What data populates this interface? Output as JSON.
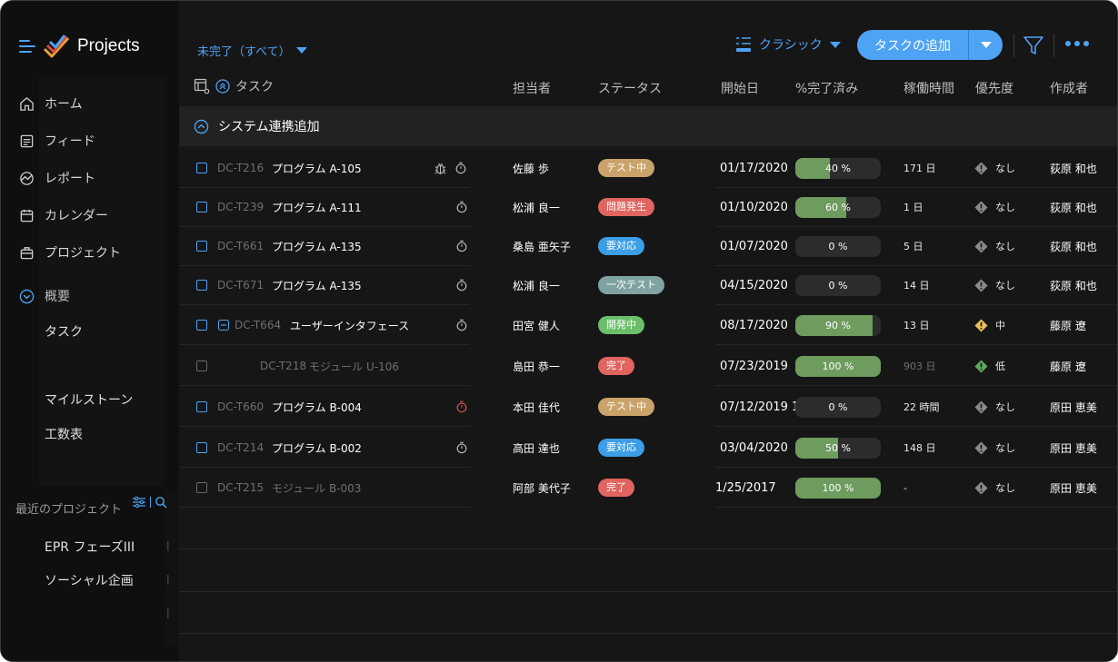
{
  "app": {
    "title": "Projects"
  },
  "sidebar": {
    "nav": [
      {
        "label": "ホーム",
        "icon": "home-icon"
      },
      {
        "label": "フィード",
        "icon": "feed-icon"
      },
      {
        "label": "レポート",
        "icon": "report-icon"
      },
      {
        "label": "カレンダー",
        "icon": "calendar-icon"
      },
      {
        "label": "プロジェクト",
        "icon": "briefcase-icon"
      }
    ],
    "overview": {
      "label": "概要",
      "icon": "chevron-down-circle-icon"
    },
    "sub_items": [
      "タスク",
      "マイルストーン",
      "工数表"
    ],
    "recent_label": "最近のプロジェクト",
    "recent_projects": [
      "EPR フェーズIII",
      "ソーシャル企画"
    ]
  },
  "toolbar": {
    "filter_label": "未完了（すべて）",
    "view_label": "クラシック",
    "add_task_label": "タスクの追加"
  },
  "table": {
    "headers": {
      "task": "タスク",
      "assignee": "担当者",
      "status": "ステータス",
      "start": "開始日",
      "percent": "%完了済み",
      "hours": "稼働時間",
      "priority": "優先度",
      "creator": "作成者"
    },
    "group": "システム連携追加",
    "rows": [
      {
        "id": "DC-T216",
        "name": "プログラム A-105",
        "assignee": "佐藤 歩",
        "status": "テスト中",
        "status_color": "#c9a36a",
        "start": "01/17/2020",
        "percent": 40,
        "percent_label": "40 %",
        "hours": "171 日",
        "priority": "なし",
        "priority_color": "#8a8a8a",
        "creator": "荻原 和也",
        "icons": [
          "bug-icon",
          "timer-icon"
        ]
      },
      {
        "id": "DC-T239",
        "name": "プログラム A-111",
        "assignee": "松浦 良一",
        "status": "問題発生",
        "status_color": "#e0645f",
        "start": "01/10/2020",
        "percent": 60,
        "percent_label": "60 %",
        "hours": "1 日",
        "priority": "なし",
        "priority_color": "#8a8a8a",
        "creator": "荻原 和也",
        "icons": [
          "timer-icon"
        ]
      },
      {
        "id": "DC-T661",
        "name": "プログラム A-135",
        "assignee": "桑島 亜矢子",
        "status": "要対応",
        "status_color": "#3b9ee6",
        "start": "01/07/2020",
        "percent": 0,
        "percent_label": "0 %",
        "hours": "5 日",
        "priority": "なし",
        "priority_color": "#8a8a8a",
        "creator": "荻原 和也",
        "icons": [
          "timer-icon"
        ]
      },
      {
        "id": "DC-T671",
        "name": "プログラム A-135",
        "assignee": "松浦 良一",
        "status": "一次テスト",
        "status_color": "#7fa3a3",
        "start": "04/15/2020",
        "percent": 0,
        "percent_label": "0 %",
        "hours": "14 日",
        "priority": "なし",
        "priority_color": "#8a8a8a",
        "creator": "荻原 和也",
        "icons": [
          "timer-icon"
        ]
      },
      {
        "id": "DC-T664",
        "name": "ユーザーインタフェース",
        "assignee": "田宮 健人",
        "status": "開発中",
        "status_color": "#6bbf6b",
        "start": "08/17/2020",
        "percent": 90,
        "percent_label": "90 %",
        "hours": "13 日",
        "priority": "中",
        "priority_color": "#e8c05a",
        "creator": "藤原 遼",
        "icons": [
          "timer-icon"
        ],
        "subtask": true
      },
      {
        "id": "DC-T218",
        "name": "モジュール U-106",
        "assignee": "島田 恭一",
        "status": "完了",
        "status_color": "#e0645f",
        "start": "07/23/2019",
        "percent": 100,
        "percent_label": "100 %",
        "hours": "903 日",
        "priority": "低",
        "priority_color": "#5eaa5e",
        "creator": "藤原 遼",
        "icons": [],
        "completed": true
      },
      {
        "id": "DC-T660",
        "name": "プログラム B-004",
        "assignee": "本田 佳代",
        "status": "テスト中",
        "status_color": "#c9a36a",
        "start": "07/12/2019 1..",
        "percent": 0,
        "percent_label": "0 %",
        "hours": "22 時間",
        "priority": "なし",
        "priority_color": "#8a8a8a",
        "creator": "原田 恵美",
        "icons": [
          "timer-red-icon"
        ]
      },
      {
        "id": "DC-T214",
        "name": "プログラム B-002",
        "assignee": "高田 達也",
        "status": "要対応",
        "status_color": "#3b9ee6",
        "start": "03/04/2020",
        "percent": 50,
        "percent_label": "50 %",
        "hours": "148 日",
        "priority": "なし",
        "priority_color": "#8a8a8a",
        "creator": "原田 恵美",
        "icons": [
          "timer-icon"
        ]
      },
      {
        "id": "DC-T215",
        "name": "モジュール B-003",
        "assignee": "阿部 美代子",
        "status": "完了",
        "status_color": "#e0645f",
        "start": "1/25/2017",
        "percent": 100,
        "percent_label": "100 %",
        "hours": "-",
        "priority": "なし",
        "priority_color": "#8a8a8a",
        "creator": "原田 恵美",
        "icons": [],
        "completed": true
      }
    ]
  },
  "colors": {
    "accent": "#4ea3f5",
    "progress": "#6e9b5e",
    "background": "#161616"
  }
}
